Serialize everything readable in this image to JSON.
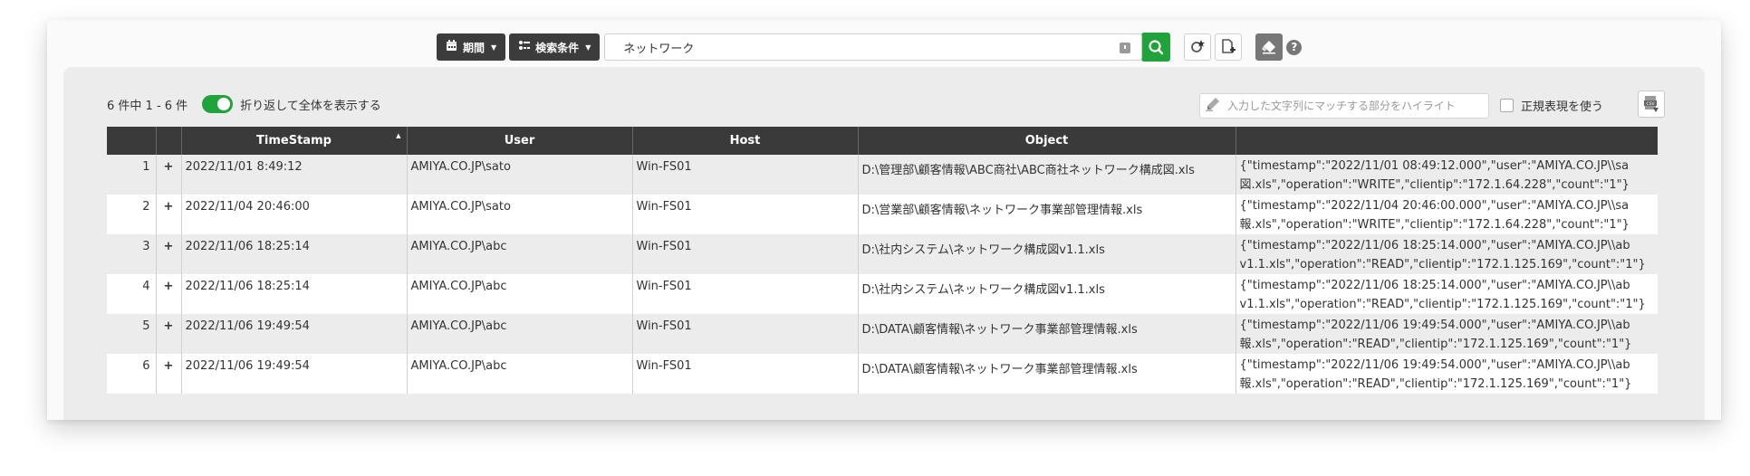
{
  "toolbar": {
    "period_label": "期間",
    "conditions_label": "検索条件",
    "search_value": "ネットワーク"
  },
  "result": {
    "count_text": "6 件中 1 - 6 件",
    "wrap_toggle_label": "折り返して全体を表示する",
    "wrap_enabled": true
  },
  "highlight": {
    "placeholder": "入力した文字列にマッチする部分をハイライト",
    "regex_label": "正規表現を使う"
  },
  "colors": {
    "accent": "#1fa33a",
    "header_bg": "#3a3a3a"
  },
  "table": {
    "columns": [
      "",
      "",
      "TimeStamp",
      "User",
      "Host",
      "Object",
      ""
    ],
    "rows": [
      {
        "index": "1",
        "expand": "+",
        "timestamp": "2022/11/01 8:49:12",
        "user": "AMIYA.CO.JP\\sato",
        "host": "Win-FS01",
        "object": "D:\\管理部\\顧客情報\\ABC商社\\ABC商社ネットワーク構成図.xls",
        "raw_line1": "{\"timestamp\":\"2022/11/01 08:49:12.000\",\"user\":\"AMIYA.CO.JP\\\\sa",
        "raw_line2": "図.xls\",\"operation\":\"WRITE\",\"clientip\":\"172.1.64.228\",\"count\":\"1\"}"
      },
      {
        "index": "2",
        "expand": "+",
        "timestamp": "2022/11/04 20:46:00",
        "user": "AMIYA.CO.JP\\sato",
        "host": "Win-FS01",
        "object": "D:\\営業部\\顧客情報\\ネットワーク事業部管理情報.xls",
        "raw_line1": "{\"timestamp\":\"2022/11/04 20:46:00.000\",\"user\":\"AMIYA.CO.JP\\\\sa",
        "raw_line2": "報.xls\",\"operation\":\"WRITE\",\"clientip\":\"172.1.64.228\",\"count\":\"1\"}"
      },
      {
        "index": "3",
        "expand": "+",
        "timestamp": "2022/11/06 18:25:14",
        "user": "AMIYA.CO.JP\\abc",
        "host": "Win-FS01",
        "object": "D:\\社内システム\\ネットワーク構成図v1.1.xls",
        "raw_line1": "{\"timestamp\":\"2022/11/06 18:25:14.000\",\"user\":\"AMIYA.CO.JP\\\\ab",
        "raw_line2": "v1.1.xls\",\"operation\":\"READ\",\"clientip\":\"172.1.125.169\",\"count\":\"1\"}"
      },
      {
        "index": "4",
        "expand": "+",
        "timestamp": "2022/11/06 18:25:14",
        "user": "AMIYA.CO.JP\\abc",
        "host": "Win-FS01",
        "object": "D:\\社内システム\\ネットワーク構成図v1.1.xls",
        "raw_line1": "{\"timestamp\":\"2022/11/06 18:25:14.000\",\"user\":\"AMIYA.CO.JP\\\\ab",
        "raw_line2": "v1.1.xls\",\"operation\":\"READ\",\"clientip\":\"172.1.125.169\",\"count\":\"1\"}"
      },
      {
        "index": "5",
        "expand": "+",
        "timestamp": "2022/11/06 19:49:54",
        "user": "AMIYA.CO.JP\\abc",
        "host": "Win-FS01",
        "object": "D:\\DATA\\顧客情報\\ネットワーク事業部管理情報.xls",
        "raw_line1": "{\"timestamp\":\"2022/11/06 19:49:54.000\",\"user\":\"AMIYA.CO.JP\\\\ab",
        "raw_line2": "報.xls\",\"operation\":\"READ\",\"clientip\":\"172.1.125.169\",\"count\":\"1\"}"
      },
      {
        "index": "6",
        "expand": "+",
        "timestamp": "2022/11/06 19:49:54",
        "user": "AMIYA.CO.JP\\abc",
        "host": "Win-FS01",
        "object": "D:\\DATA\\顧客情報\\ネットワーク事業部管理情報.xls",
        "raw_line1": "{\"timestamp\":\"2022/11/06 19:49:54.000\",\"user\":\"AMIYA.CO.JP\\\\ab",
        "raw_line2": "報.xls\",\"operation\":\"READ\",\"clientip\":\"172.1.125.169\",\"count\":\"1\"}"
      }
    ]
  }
}
